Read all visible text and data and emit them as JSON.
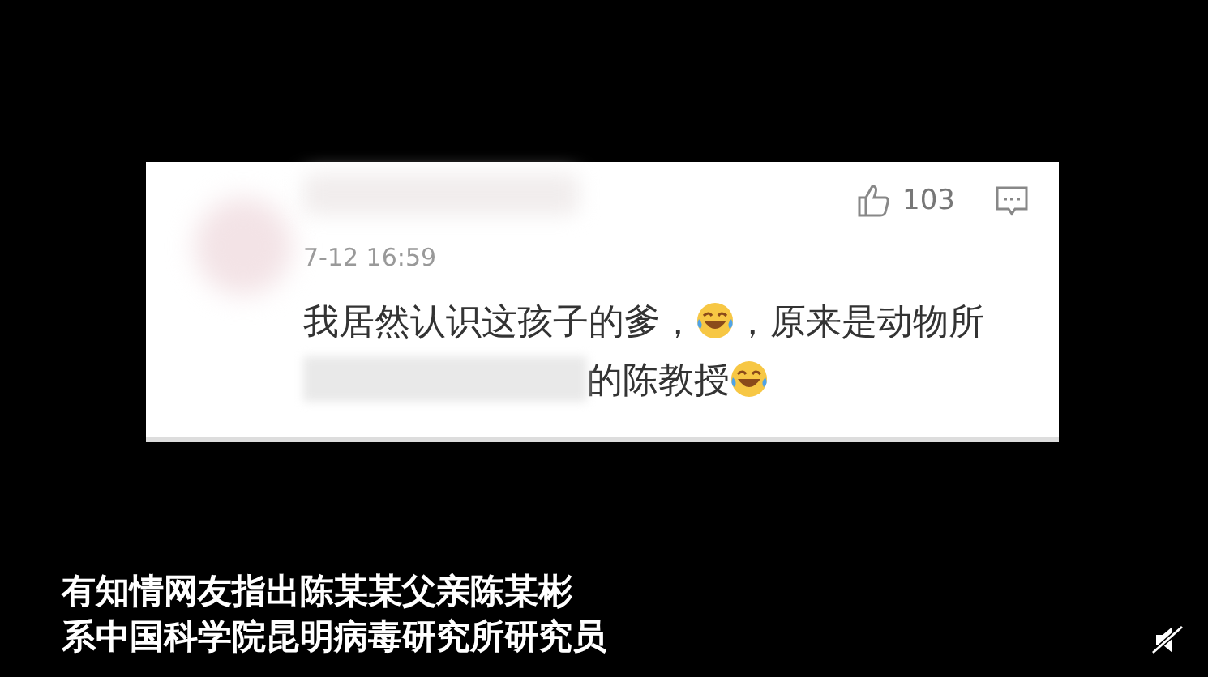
{
  "comment": {
    "likes": "103",
    "time": "7-12 16:59",
    "body": [
      {
        "kind": "text",
        "text": "我居然认识这孩子的爹，"
      },
      {
        "kind": "emoji"
      },
      {
        "kind": "text",
        "text": "，原来是动物所"
      },
      {
        "kind": "redacted"
      },
      {
        "kind": "text",
        "text": "的陈教授"
      },
      {
        "kind": "emoji"
      }
    ]
  },
  "caption": [
    "有知情网友指出陈某某父亲陈某彬",
    "系中国科学院昆明病毒研究所研究员"
  ],
  "player": {
    "muted": true
  }
}
